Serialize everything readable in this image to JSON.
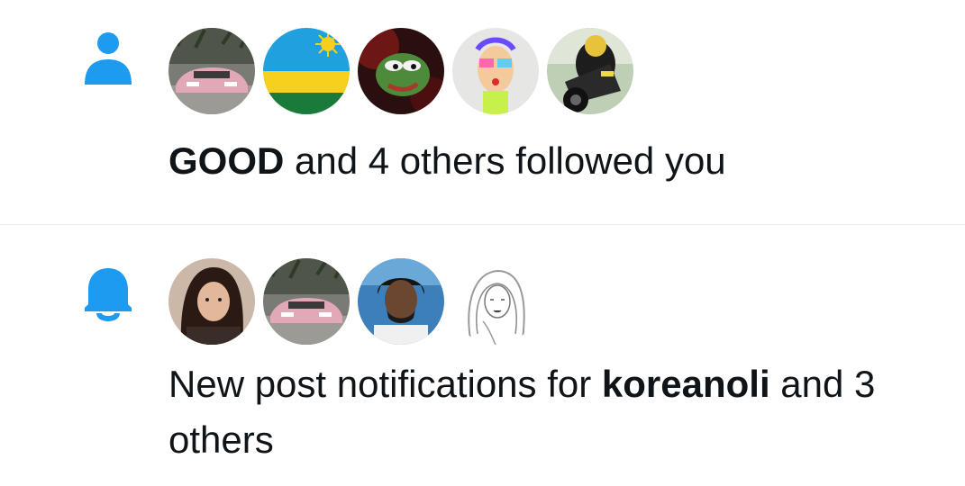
{
  "colors": {
    "accent": "#1d9bf0",
    "divider": "#e6ecf0",
    "text": "#0f1419"
  },
  "notifications": [
    {
      "type_icon": "person-icon",
      "avatars": [
        "pink-sports-car",
        "rwanda-flag",
        "pepe-frog",
        "abstract-art",
        "motorcycle-rider"
      ],
      "bold_name": "GOOD",
      "text_after": " and 4 others followed you"
    },
    {
      "type_icon": "bell-icon",
      "avatars": [
        "woman-portrait",
        "pink-sports-car",
        "man-portrait",
        "sketch-drawing"
      ],
      "text_before": "New post notifications for ",
      "bold_name": "koreanoli",
      "text_after": " and 3 others"
    }
  ]
}
